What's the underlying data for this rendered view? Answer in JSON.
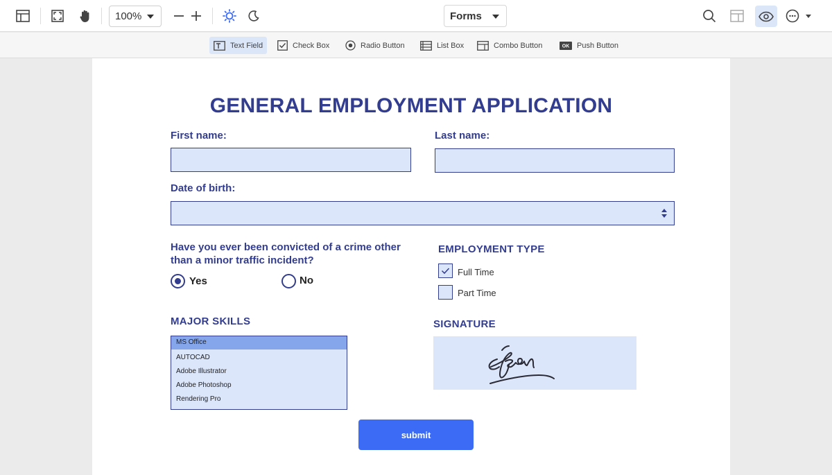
{
  "toolbar": {
    "zoom": "100%",
    "mode": "Forms"
  },
  "formbar": {
    "items": [
      {
        "label": "Text Field",
        "icon": "text-field-icon"
      },
      {
        "label": "Check Box",
        "icon": "check-box-icon"
      },
      {
        "label": "Radio Button",
        "icon": "radio-button-icon"
      },
      {
        "label": "List Box",
        "icon": "list-box-icon"
      },
      {
        "label": "Combo Button",
        "icon": "combo-button-icon"
      },
      {
        "label": "Push Button",
        "icon": "push-button-icon"
      }
    ],
    "push_badge": "OK"
  },
  "form": {
    "title": "GENERAL EMPLOYMENT APPLICATION",
    "first_name_label": "First name:",
    "last_name_label": "Last name:",
    "dob_label": "Date of birth:",
    "question": "Have you ever been convicted of a crime other than a minor traffic incident?",
    "yes_label": "Yes",
    "no_label": "No",
    "yes_selected": true,
    "employment_type_title": "EMPLOYMENT TYPE",
    "full_time_label": "Full Time",
    "part_time_label": "Part Time",
    "full_time_checked": true,
    "part_time_checked": false,
    "skills_title": "MAJOR SKILLS",
    "skills": [
      "MS Office",
      "AUTOCAD",
      "Adobe Illustrator",
      "Adobe Photoshop",
      "Rendering Pro"
    ],
    "selected_skill": "MS Office",
    "signature_title": "SIGNATURE",
    "submit_label": "submit"
  },
  "colors": {
    "accent": "#333d8f",
    "field_fill": "#dbe6fb",
    "submit": "#3c6cf5",
    "active_tool": "#dbe6f9"
  }
}
